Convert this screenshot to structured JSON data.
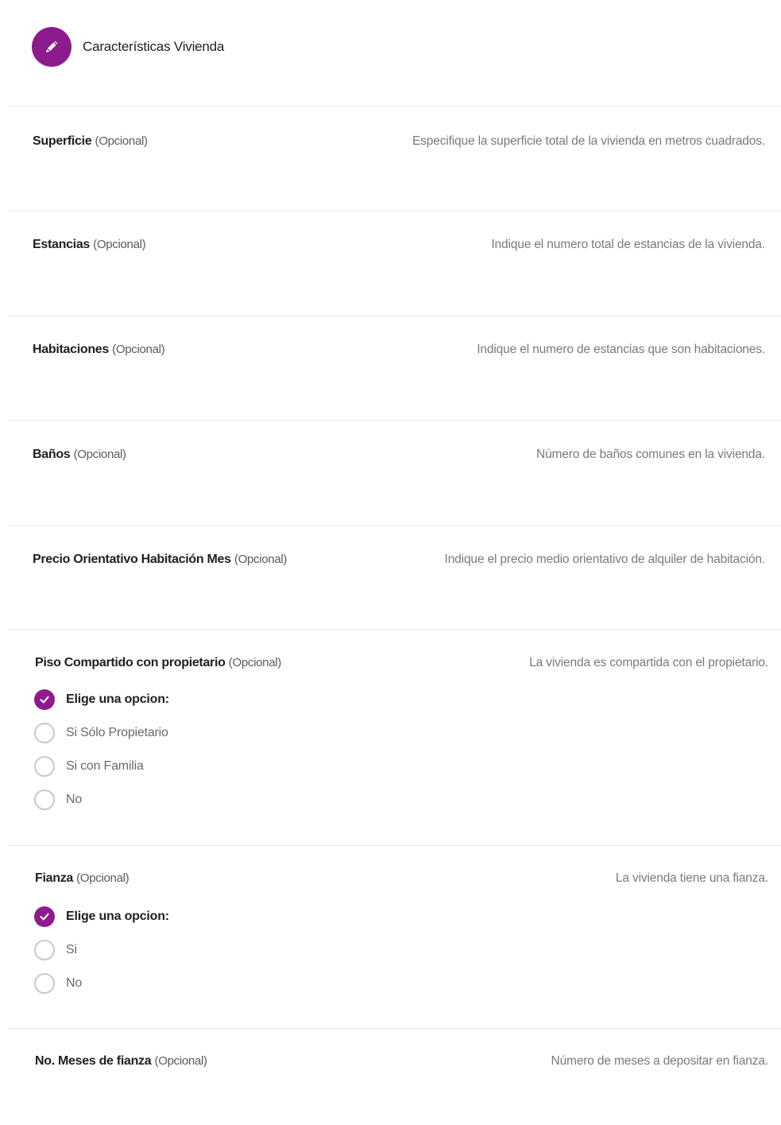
{
  "header": {
    "title": "Características Vivienda",
    "icon": "pencil-icon",
    "accent": "#8e1b8e"
  },
  "fields": [
    {
      "label": "Superficie",
      "optional": "(Opcional)",
      "help": "Especifique la superficie total de la vivienda en metros cuadrados."
    },
    {
      "label": "Estancias",
      "optional": "(Opcional)",
      "help": "Indique el numero total de estancias de la vivienda."
    },
    {
      "label": "Habitaciones",
      "optional": "(Opcional)",
      "help": "Indique el numero de estancias que son habitaciones."
    },
    {
      "label": "Baños",
      "optional": "(Opcional)",
      "help": "Número de baños comunes en la vivienda."
    },
    {
      "label": "Precio Orientativo Habitación Mes",
      "optional": "(Opcional)",
      "help": "Indique el precio medio orientativo de alquiler de habitación."
    },
    {
      "label": "Piso Compartido con propietario",
      "optional": "(Opcional)",
      "help": "La vivienda es compartida con el propietario.",
      "options": [
        "Elige una opcion:",
        "Si Sólo Propietario",
        "Si con Familia",
        "No"
      ],
      "selected": "Elige una opcion:"
    },
    {
      "label": "Fianza",
      "optional": "(Opcional)",
      "help": "La vivienda tiene una fianza.",
      "options": [
        "Elige una opcion:",
        "Si",
        "No"
      ],
      "selected": "Elige una opcion:"
    },
    {
      "label": "No. Meses de fianza",
      "optional": "(Opcional)",
      "help": "Número de meses a depositar en fianza."
    }
  ]
}
